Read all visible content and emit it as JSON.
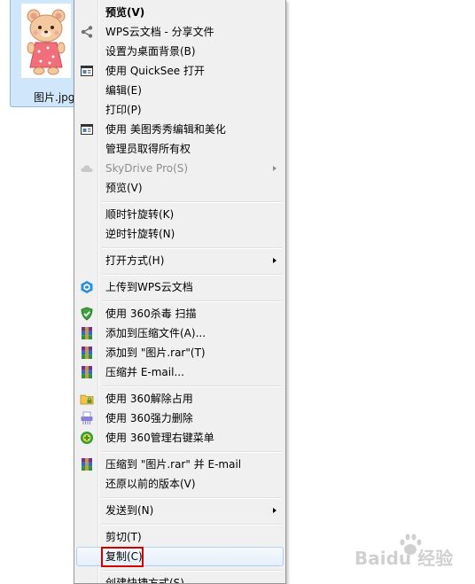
{
  "desktop": {
    "file_label": "图片.jpg"
  },
  "menu": {
    "items": [
      {
        "label": "预览(V)",
        "icon": "none"
      },
      {
        "label": "WPS云文档 - 分享文件",
        "icon": "share-icon"
      },
      {
        "label": "设置为桌面背景(B)",
        "icon": "none"
      },
      {
        "label": "使用 QuickSee 打开",
        "icon": "app-window-icon"
      },
      {
        "label": "编辑(E)",
        "icon": "none"
      },
      {
        "label": "打印(P)",
        "icon": "none"
      },
      {
        "label": "使用 美图秀秀编辑和美化",
        "icon": "app-window-icon"
      },
      {
        "label": "管理员取得所有权",
        "icon": "none"
      },
      {
        "label": "SkyDrive Pro(S)",
        "icon": "cloud-icon",
        "disabled": true,
        "submenu": true
      },
      {
        "label": "预览(V)",
        "icon": "none"
      },
      {
        "label": "顺时针旋转(K)",
        "icon": "none"
      },
      {
        "label": "逆时针旋转(N)",
        "icon": "none"
      },
      {
        "label": "打开方式(H)",
        "icon": "none",
        "submenu": true
      },
      {
        "label": "上传到WPS云文档",
        "icon": "wps-cloud-icon"
      },
      {
        "label": "使用 360杀毒 扫描",
        "icon": "shield-icon"
      },
      {
        "label": "添加到压缩文件(A)...",
        "icon": "winrar-icon"
      },
      {
        "label": "添加到 \"图片.rar\"(T)",
        "icon": "winrar-icon"
      },
      {
        "label": "压缩并 E-mail...",
        "icon": "winrar-icon"
      },
      {
        "label": "使用 360解除占用",
        "icon": "folder-lock-icon"
      },
      {
        "label": "使用 360强力删除",
        "icon": "shredder-icon"
      },
      {
        "label": "使用 360管理右键菜单",
        "icon": "plus-circle-icon"
      },
      {
        "label": "压缩到 \"图片.rar\" 并 E-mail",
        "icon": "winrar-icon"
      },
      {
        "label": "还原以前的版本(V)",
        "icon": "none"
      },
      {
        "label": "发送到(N)",
        "icon": "none",
        "submenu": true
      },
      {
        "label": "剪切(T)",
        "icon": "none"
      },
      {
        "label": "复制(C)",
        "icon": "none",
        "highlighted": true
      },
      {
        "label": "创建快捷方式(S)",
        "icon": "none"
      }
    ]
  },
  "watermark": {
    "text": "Baidu 经验"
  },
  "colors": {
    "menu_bg": "#f0f0f0",
    "highlight_border": "#aecff7",
    "annotation_red": "#d40000"
  }
}
